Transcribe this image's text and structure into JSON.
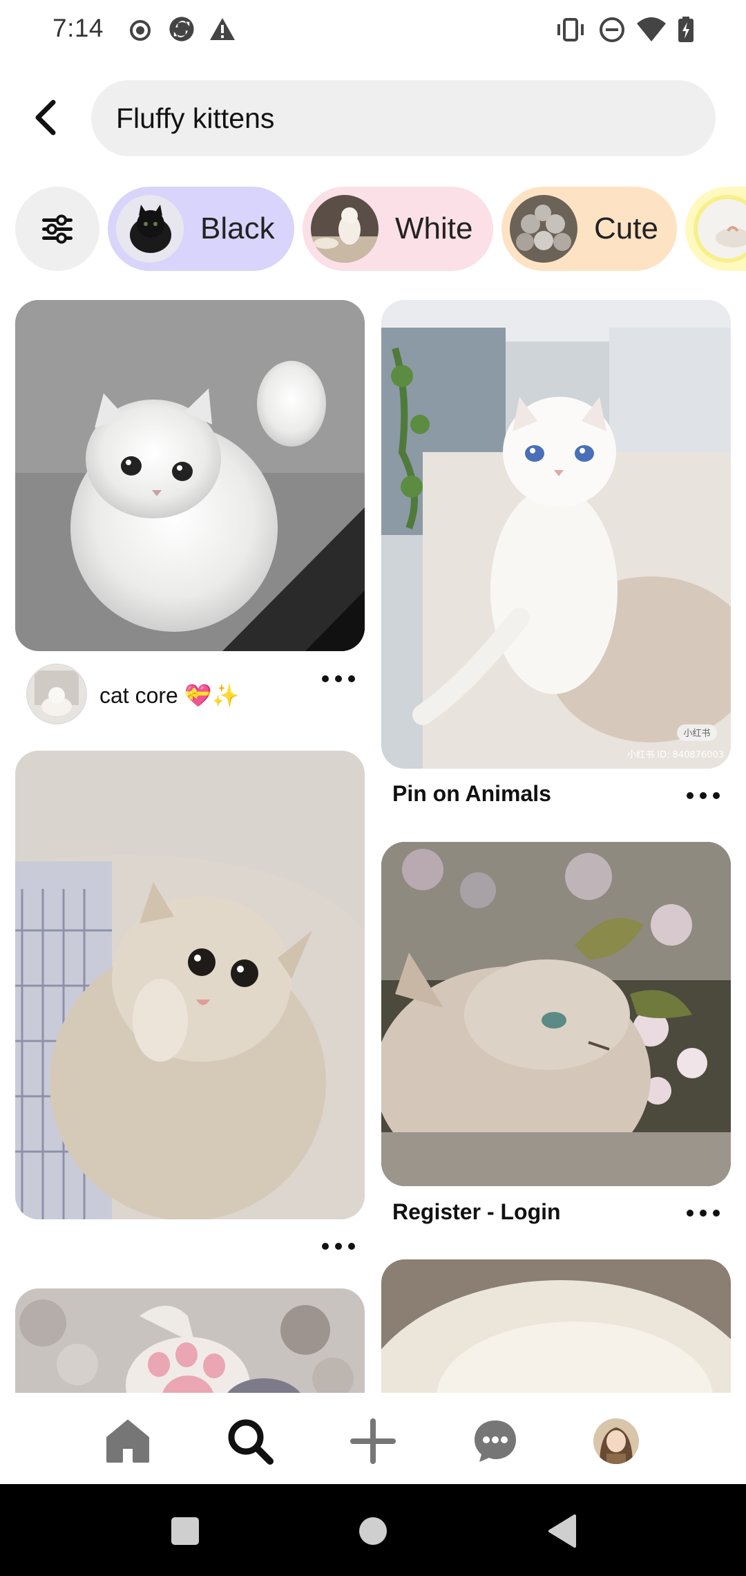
{
  "status_bar": {
    "time": "7:14",
    "left_icons": [
      "record-icon",
      "sync-icon",
      "warning-icon"
    ],
    "right_icons": [
      "vibrate-icon",
      "do-not-disturb-icon",
      "wifi-icon",
      "battery-icon"
    ]
  },
  "search": {
    "query": "Fluffy kittens"
  },
  "filters": {
    "chips": [
      {
        "label": "Black",
        "bg": "#d8d4fb"
      },
      {
        "label": "White",
        "bg": "#fbe0e7"
      },
      {
        "label": "Cute",
        "bg": "#fde3c4"
      },
      {
        "label": "",
        "bg": "#fff9c0"
      }
    ]
  },
  "pins": [
    {
      "title": "cat core 💝✨"
    },
    {
      "title": "Pin on Animals"
    },
    {
      "title": "Register - Login"
    },
    {
      "title": ""
    }
  ],
  "watermark": {
    "brand": "小红书",
    "id": "小红书 ID: 840876003"
  },
  "bottom_nav": {
    "items": [
      "home-icon",
      "search-icon",
      "add-icon",
      "messages-icon",
      "profile-avatar"
    ],
    "active": "search-icon"
  },
  "colors": {
    "accent": "#111111",
    "chip_black": "#d8d4fb",
    "chip_white": "#fbe0e7",
    "chip_cute": "#fde3c4",
    "chip_next": "#fff9c0"
  }
}
